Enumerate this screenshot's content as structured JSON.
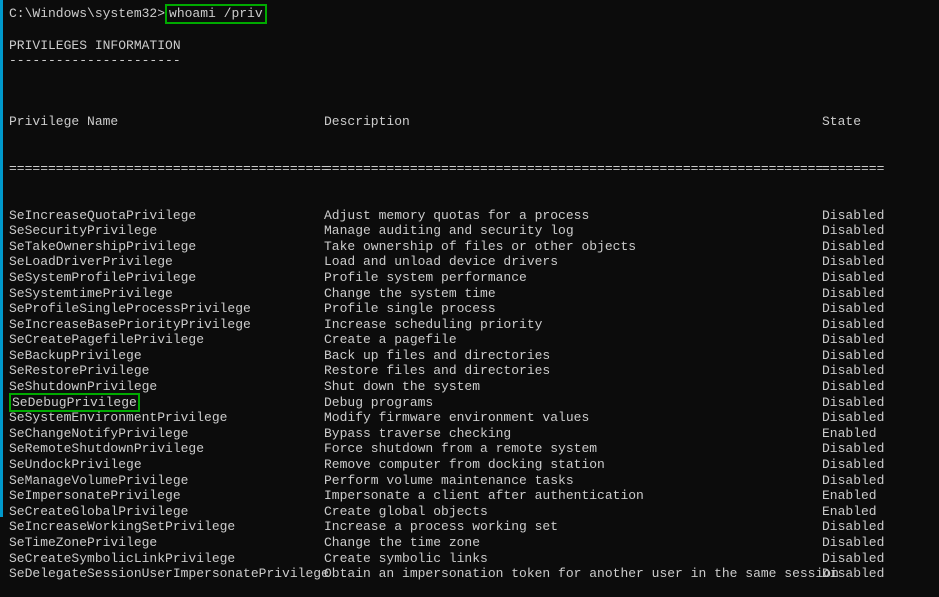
{
  "prompt": {
    "path": "C:\\Windows\\system32>",
    "command": "whoami /priv"
  },
  "section_title": "PRIVILEGES INFORMATION",
  "section_underline": "----------------------",
  "headers": {
    "name": "Privilege Name",
    "desc": "Description",
    "state": "State"
  },
  "separators": {
    "name": "=========================================",
    "desc": "================================================================",
    "state": "========"
  },
  "highlighted_privilege_index": 12,
  "privileges": [
    {
      "name": "SeIncreaseQuotaPrivilege",
      "desc": "Adjust memory quotas for a process",
      "state": "Disabled"
    },
    {
      "name": "SeSecurityPrivilege",
      "desc": "Manage auditing and security log",
      "state": "Disabled"
    },
    {
      "name": "SeTakeOwnershipPrivilege",
      "desc": "Take ownership of files or other objects",
      "state": "Disabled"
    },
    {
      "name": "SeLoadDriverPrivilege",
      "desc": "Load and unload device drivers",
      "state": "Disabled"
    },
    {
      "name": "SeSystemProfilePrivilege",
      "desc": "Profile system performance",
      "state": "Disabled"
    },
    {
      "name": "SeSystemtimePrivilege",
      "desc": "Change the system time",
      "state": "Disabled"
    },
    {
      "name": "SeProfileSingleProcessPrivilege",
      "desc": "Profile single process",
      "state": "Disabled"
    },
    {
      "name": "SeIncreaseBasePriorityPrivilege",
      "desc": "Increase scheduling priority",
      "state": "Disabled"
    },
    {
      "name": "SeCreatePagefilePrivilege",
      "desc": "Create a pagefile",
      "state": "Disabled"
    },
    {
      "name": "SeBackupPrivilege",
      "desc": "Back up files and directories",
      "state": "Disabled"
    },
    {
      "name": "SeRestorePrivilege",
      "desc": "Restore files and directories",
      "state": "Disabled"
    },
    {
      "name": "SeShutdownPrivilege",
      "desc": "Shut down the system",
      "state": "Disabled"
    },
    {
      "name": "SeDebugPrivilege",
      "desc": "Debug programs",
      "state": "Disabled"
    },
    {
      "name": "SeSystemEnvironmentPrivilege",
      "desc": "Modify firmware environment values",
      "state": "Disabled"
    },
    {
      "name": "SeChangeNotifyPrivilege",
      "desc": "Bypass traverse checking",
      "state": "Enabled"
    },
    {
      "name": "SeRemoteShutdownPrivilege",
      "desc": "Force shutdown from a remote system",
      "state": "Disabled"
    },
    {
      "name": "SeUndockPrivilege",
      "desc": "Remove computer from docking station",
      "state": "Disabled"
    },
    {
      "name": "SeManageVolumePrivilege",
      "desc": "Perform volume maintenance tasks",
      "state": "Disabled"
    },
    {
      "name": "SeImpersonatePrivilege",
      "desc": "Impersonate a client after authentication",
      "state": "Enabled"
    },
    {
      "name": "SeCreateGlobalPrivilege",
      "desc": "Create global objects",
      "state": "Enabled"
    },
    {
      "name": "SeIncreaseWorkingSetPrivilege",
      "desc": "Increase a process working set",
      "state": "Disabled"
    },
    {
      "name": "SeTimeZonePrivilege",
      "desc": "Change the time zone",
      "state": "Disabled"
    },
    {
      "name": "SeCreateSymbolicLinkPrivilege",
      "desc": "Create symbolic links",
      "state": "Disabled"
    },
    {
      "name": "SeDelegateSessionUserImpersonatePrivilege",
      "desc": "Obtain an impersonation token for another user in the same session",
      "state": "Disabled"
    }
  ]
}
